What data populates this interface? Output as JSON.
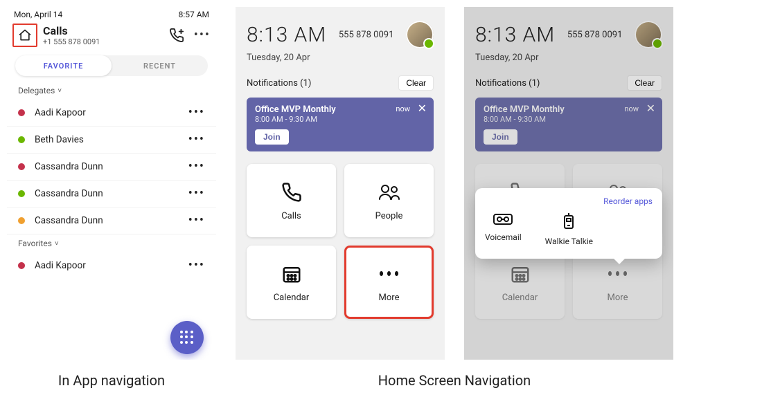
{
  "captions": {
    "in_app": "In App navigation",
    "home": "Home Screen Navigation"
  },
  "panel1": {
    "status": {
      "date": "Mon, April 14",
      "time": "8:57 AM"
    },
    "title": "Calls",
    "phone_number": "+1 555 878 0091",
    "tabs": {
      "favorite": "FAVORITE",
      "recent": "RECENT"
    },
    "sections": {
      "delegates": {
        "header": "Delegates",
        "items": [
          {
            "name": "Aadi Kapoor",
            "presence": "red"
          },
          {
            "name": "Beth Davies",
            "presence": "green"
          },
          {
            "name": "Cassandra Dunn",
            "presence": "red"
          },
          {
            "name": "Cassandra Dunn",
            "presence": "green"
          },
          {
            "name": "Cassandra Dunn",
            "presence": "amber"
          }
        ]
      },
      "favorites": {
        "header": "Favorites",
        "items": [
          {
            "name": "Aadi Kapoor",
            "presence": "red"
          }
        ]
      }
    }
  },
  "home_screen": {
    "clock": "8:13 AM",
    "phone_number": "555 878 0091",
    "date": "Tuesday, 20 Apr",
    "notifications": {
      "header": "Notifications (1)",
      "clear": "Clear",
      "card": {
        "title": "Office MVP Monthly",
        "time": "8:00 AM - 9:30 AM",
        "badge": "now",
        "join": "Join"
      }
    },
    "tiles": {
      "calls": "Calls",
      "people": "People",
      "calendar": "Calendar",
      "more": "More"
    },
    "popover": {
      "reorder": "Reorder apps",
      "voicemail": "Voicemail",
      "walkie": "Walkie Talkie"
    }
  }
}
